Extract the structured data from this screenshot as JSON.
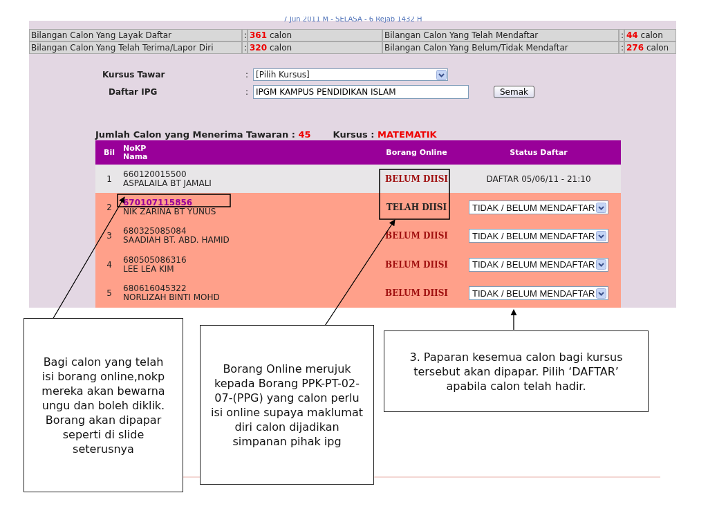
{
  "date_line": "7 Jun 2011 M - SELASA - 6 Rejab 1432 H",
  "stats": [
    {
      "label": "Bilangan Calon Yang Layak Daftar",
      "colon": ":",
      "count": "361",
      "unit": "calon"
    },
    {
      "label": "Bilangan Calon Yang Telah Mendaftar",
      "colon": ":",
      "count": "44",
      "unit": "calon"
    },
    {
      "label": "Bilangan Calon Yang Telah Terima/Lapor Diri",
      "colon": ":",
      "count": "320",
      "unit": "calon"
    },
    {
      "label": "Bilangan Calon Yang Belum/Tidak Mendaftar",
      "colon": ":",
      "count": "276",
      "unit": "calon"
    }
  ],
  "form": {
    "course_label": "Kursus Tawar",
    "course_colon": ":",
    "course_value": "[Pilih Kursus]",
    "ipg_label": "Daftar IPG",
    "ipg_colon": ":",
    "ipg_value": "IPGM KAMPUS PENDIDIKAN ISLAM",
    "check_button": "Semak"
  },
  "summary": {
    "accepted_label": "Jumlah Calon yang Menerima Tawaran",
    "accepted_colon": ":",
    "accepted_count": "45",
    "course_label": "Kursus",
    "course_colon": ":",
    "course_value": "MATEMATIK"
  },
  "table": {
    "columns": [
      "Bil",
      "NoKP",
      "Nama",
      "Borang Online",
      "Status Daftar"
    ],
    "rows": [
      {
        "no": "1",
        "nokp": "660120015500",
        "name": "ASPALAILA BT JAMALI",
        "form_status": "BELUM DIISI",
        "form_filled": false,
        "nokp_link": false,
        "kind": "registered",
        "status": "DAFTAR 05/06/11 - 21:10"
      },
      {
        "no": "2",
        "nokp": "670107115856",
        "name": "NIK ZARINA BT YUNUS",
        "form_status": "TELAH DIISI",
        "form_filled": true,
        "nokp_link": true,
        "kind": "pending",
        "status": "TIDAK / BELUM MENDAFTAR"
      },
      {
        "no": "3",
        "nokp": "680325085084",
        "name": "SAADIAH BT. ABD. HAMID",
        "form_status": "BELUM DIISI",
        "form_filled": false,
        "nokp_link": false,
        "kind": "pending",
        "status": "TIDAK / BELUM MENDAFTAR"
      },
      {
        "no": "4",
        "nokp": "680505086316",
        "name": "LEE LEA KIM",
        "form_status": "BELUM DIISI",
        "form_filled": false,
        "nokp_link": false,
        "kind": "pending",
        "status": "TIDAK / BELUM MENDAFTAR"
      },
      {
        "no": "5",
        "nokp": "680616045322",
        "name": "NORLIZAH BINTI MOHD",
        "form_status": "BELUM DIISI",
        "form_filled": false,
        "nokp_link": false,
        "kind": "pending",
        "status": "TIDAK / BELUM MENDAFTAR"
      }
    ]
  },
  "callouts": [
    {
      "text": "Bagi calon yang telah isi borang online,nokp mereka akan bewarna ungu dan boleh diklik. Borang akan dipapar seperti di slide seterusnya"
    },
    {
      "text": "Borang Online merujuk kepada Borang PPK-PT-02-07-(PPG) yang calon perlu isi online supaya maklumat diri calon dijadikan simpanan pihak ipg"
    },
    {
      "text": "3. Paparan kesemua calon bagi kursus tersebut akan dipapar. Pilih ‘DAFTAR’ apabila calon telah hadir."
    }
  ]
}
